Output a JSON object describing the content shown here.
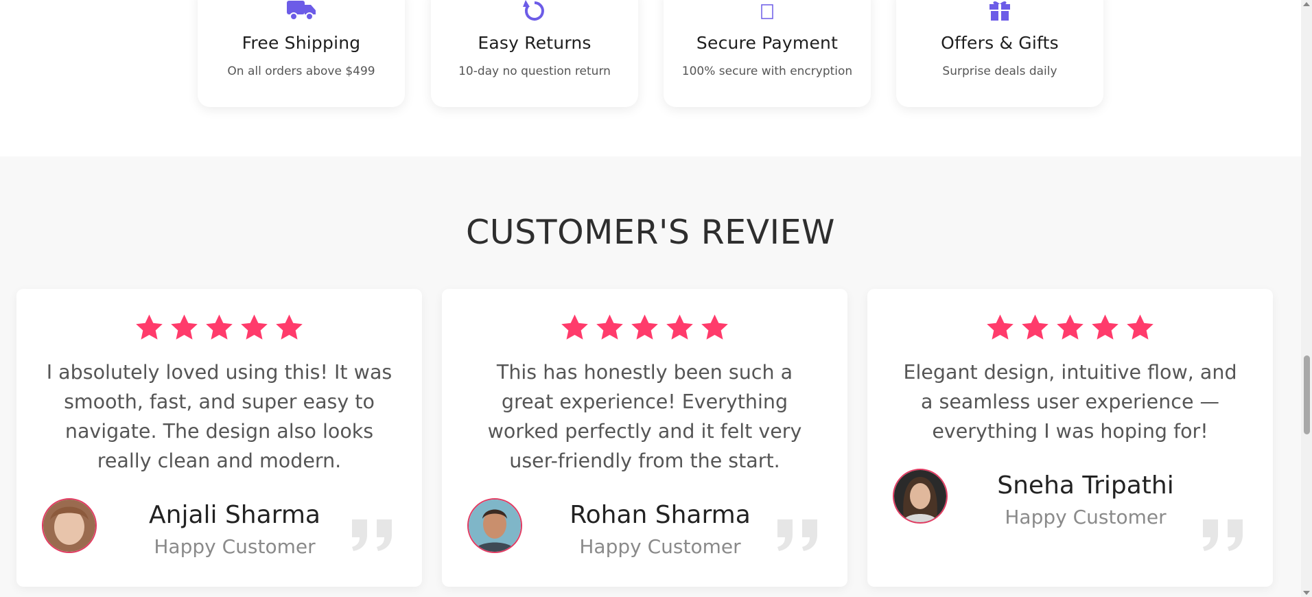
{
  "features": [
    {
      "title": "Free Shipping",
      "description": "On all orders above $499",
      "icon": "truck-icon"
    },
    {
      "title": "Easy Returns",
      "description": "10-day no question return",
      "icon": "return-arrow-icon"
    },
    {
      "title": "Secure Payment",
      "description": "100% secure with encryption",
      "icon": "missing-glyph-icon"
    },
    {
      "title": "Offers & Gifts",
      "description": "Surprise deals daily",
      "icon": "gift-icon"
    }
  ],
  "reviews_section": {
    "title": "CUSTOMER'S REVIEW",
    "reviews": [
      {
        "rating": 5,
        "text": "I absolutely loved using this! It was smooth, fast, and super easy to navigate. The design also looks really clean and modern.",
        "name": "Anjali Sharma",
        "role": "Happy Customer"
      },
      {
        "rating": 5,
        "text": "This has honestly been such a great experience! Everything worked perfectly and it felt very user-friendly from the start.",
        "name": "Rohan Sharma",
        "role": "Happy Customer"
      },
      {
        "rating": 5,
        "text": "Elegant design, intuitive flow, and a seamless user experience — everything I was hoping for!",
        "name": "Sneha Tripathi",
        "role": "Happy Customer"
      }
    ]
  },
  "colors": {
    "accent": "#6c5ce7",
    "star": "#ff3b6b",
    "avatar_border": "#e23a61",
    "quote": "#e6e6e6"
  }
}
